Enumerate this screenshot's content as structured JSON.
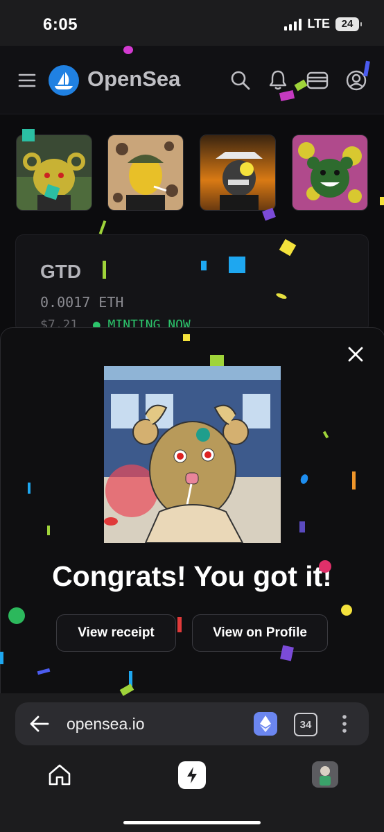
{
  "status_bar": {
    "time": "6:05",
    "network": "LTE",
    "battery": "24"
  },
  "header": {
    "logo_text": "OpenSea",
    "icons": [
      "menu-icon",
      "search-icon",
      "bell-icon",
      "wallet-icon",
      "account-icon"
    ]
  },
  "thumbnails": [
    "nft-thumbnail-1",
    "nft-thumbnail-2",
    "nft-thumbnail-3",
    "nft-thumbnail-4"
  ],
  "drop_card": {
    "title": "GTD",
    "price": "0.0017",
    "currency": "ETH",
    "usd": "$7.21",
    "status": "MINTING NOW"
  },
  "modal": {
    "headline": "Congrats! You got it!",
    "view_receipt": "View receipt",
    "view_profile": "View on Profile"
  },
  "browser": {
    "url": "opensea.io",
    "tab_count": "34"
  },
  "colors": {
    "brand_blue": "#2081e2",
    "minting_green": "#2cc46b",
    "eth_purple": "#6b86f0"
  }
}
